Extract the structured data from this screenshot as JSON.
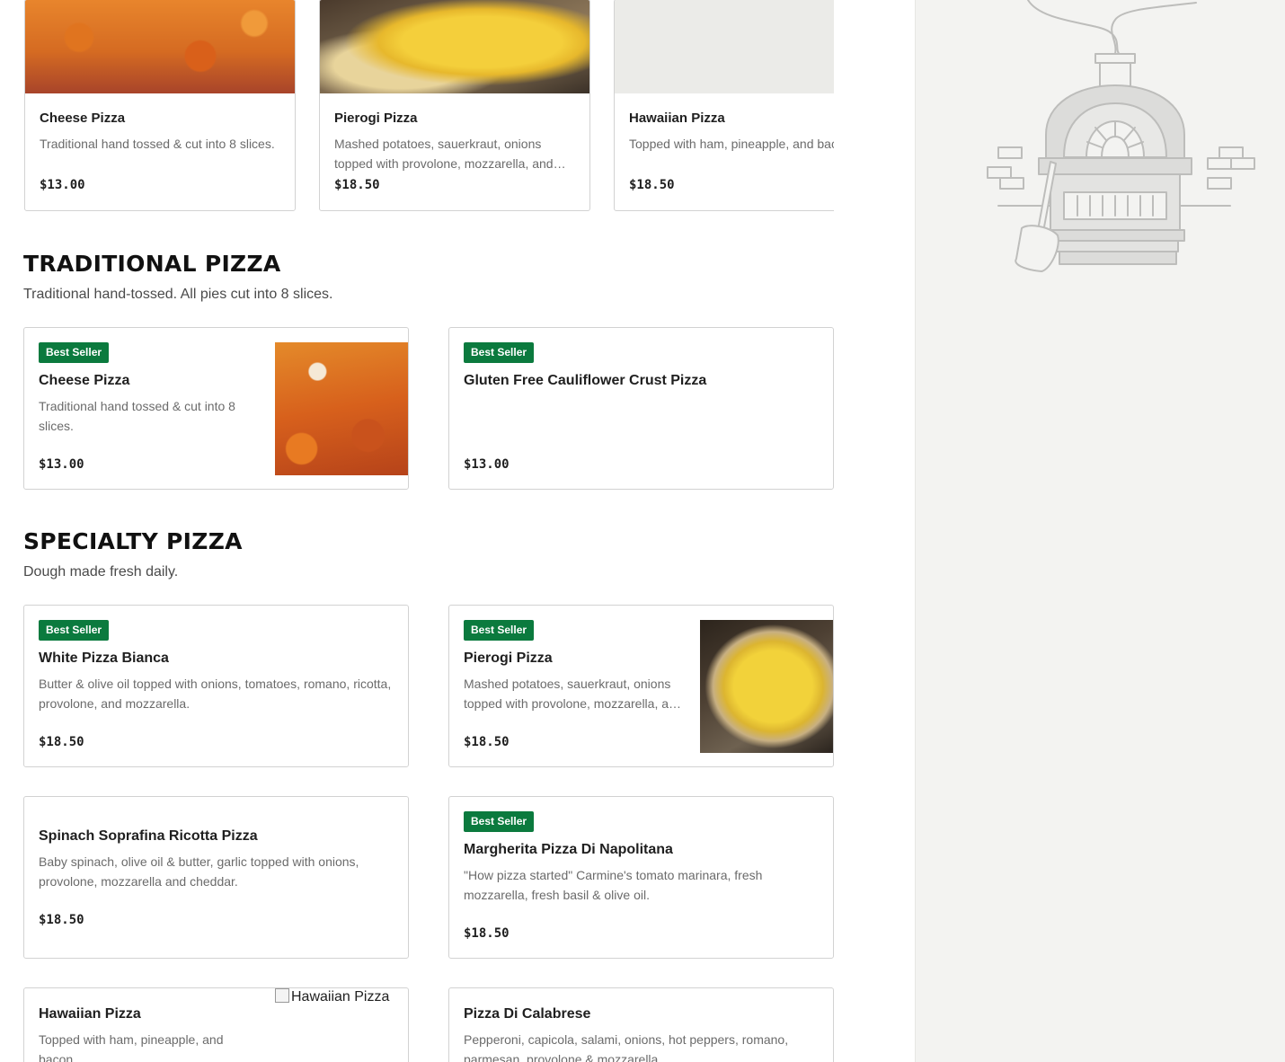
{
  "carousel": {
    "items": [
      {
        "title": "Cheese Pizza",
        "desc": "Traditional hand tossed & cut into 8 slices.",
        "price": "$13.00"
      },
      {
        "title": "Pierogi Pizza",
        "desc": "Mashed potatoes, sauerkraut, onions topped with provolone, mozzarella, and…",
        "price": "$18.50"
      },
      {
        "title": "Hawaiian Pizza",
        "desc": "Topped with ham, pineapple, and bacon.",
        "price": "$18.50"
      }
    ]
  },
  "traditional": {
    "title": "TRADITIONAL PIZZA",
    "subtitle": "Traditional hand-tossed. All pies cut into 8 slices.",
    "items": [
      {
        "badge": "Best Seller",
        "title": "Cheese Pizza",
        "desc": "Traditional hand tossed & cut into 8 slices.",
        "price": "$13.00"
      },
      {
        "badge": "Best Seller",
        "title": "Gluten Free Cauliflower Crust Pizza",
        "desc": "",
        "price": "$13.00"
      }
    ]
  },
  "specialty": {
    "title": "SPECIALTY PIZZA",
    "subtitle": "Dough made fresh daily.",
    "items": [
      {
        "badge": "Best Seller",
        "title": "White Pizza Bianca",
        "desc": "Butter & olive oil topped with onions, tomatoes, romano, ricotta, provolone, and mozzarella.",
        "price": "$18.50"
      },
      {
        "badge": "Best Seller",
        "title": "Pierogi Pizza",
        "desc": "Mashed potatoes, sauerkraut, onions topped with provolone, mozzarella, a…",
        "price": "$18.50"
      },
      {
        "badge": "",
        "title": "Spinach Soprafina Ricotta Pizza",
        "desc": "Baby spinach, olive oil & butter, garlic topped with onions, provolone, mozzarella and cheddar.",
        "price": "$18.50"
      },
      {
        "badge": "Best Seller",
        "title": "Margherita Pizza Di Napolitana",
        "desc": "\"How pizza started\" Carmine's tomato marinara, fresh mozzarella, fresh basil & olive oil.",
        "price": "$18.50"
      },
      {
        "badge": "",
        "title": "Hawaiian Pizza",
        "desc": "Topped with ham, pineapple, and bacon.",
        "price": "",
        "img_alt": "Hawaiian Pizza"
      },
      {
        "badge": "",
        "title": "Pizza Di Calabrese",
        "desc": "Pepperoni, capicola, salami, onions, hot peppers, romano, parmesan, provolone & mozzarella.",
        "price": ""
      }
    ]
  },
  "sidebar": {
    "illustration": "pizza-oven-icon"
  },
  "colors": {
    "badge": "#0b7a3e",
    "sidebar_bg": "#f3f3f1",
    "border": "#d2d2d2"
  }
}
